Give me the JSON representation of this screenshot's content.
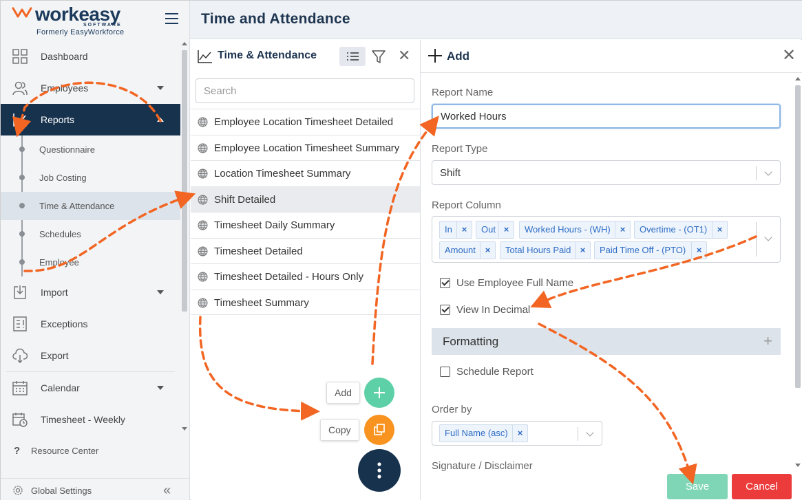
{
  "brand": {
    "name": "workeasy",
    "sub": "SOFTWARE",
    "formerly": "Formerly EasyWorkforce"
  },
  "colors": {
    "navy": "#17324d",
    "orange": "#f26522",
    "green": "#5ed0a8",
    "red": "#ec3b3b",
    "chip_blue": "#2d6cc4"
  },
  "sidebar": {
    "items": [
      {
        "label": "Dashboard",
        "icon": "grid-icon"
      },
      {
        "label": "Employees",
        "icon": "users-icon"
      },
      {
        "label": "Reports",
        "icon": "chart-icon",
        "active": true
      },
      {
        "label": "Import",
        "icon": "import-icon"
      },
      {
        "label": "Exceptions",
        "icon": "exceptions-icon"
      },
      {
        "label": "Export",
        "icon": "cloud-export-icon"
      },
      {
        "label": "Calendar",
        "icon": "calendar-icon"
      },
      {
        "label": "Timesheet - Weekly",
        "icon": "timesheet-icon"
      }
    ],
    "reports_sub": [
      "Questionnaire",
      "Job Costing",
      "Time & Attendance",
      "Schedules",
      "Employee"
    ],
    "resource_center": "Resource Center",
    "global_settings": "Global Settings"
  },
  "header": {
    "title": "Time and Attendance"
  },
  "list_panel": {
    "title": "Time & Attendance",
    "search_placeholder": "Search",
    "reports": [
      "Employee Location Timesheet Detailed",
      "Employee Location Timesheet Summary",
      "Location Timesheet Summary",
      "Shift Detailed",
      "Timesheet Daily Summary",
      "Timesheet Detailed",
      "Timesheet Detailed - Hours Only",
      "Timesheet Summary"
    ],
    "fab": {
      "add": "Add",
      "copy": "Copy"
    }
  },
  "form": {
    "title": "Add",
    "report_name_label": "Report Name",
    "report_name_value": "Worked Hours",
    "report_type_label": "Report Type",
    "report_type_value": "Shift",
    "report_column_label": "Report Column",
    "columns": [
      "In",
      "Out",
      "Worked Hours - (WH)",
      "Overtime - (OT1)",
      "Amount",
      "Total Hours Paid",
      "Paid Time Off - (PTO)"
    ],
    "use_full_name": "Use Employee Full Name",
    "view_decimal": "View In Decimal",
    "formatting": "Formatting",
    "schedule_report": "Schedule Report",
    "order_by_label": "Order by",
    "order_by_value": "Full Name (asc)",
    "signature_label": "Signature / Disclaimer",
    "save": "Save",
    "cancel": "Cancel"
  }
}
